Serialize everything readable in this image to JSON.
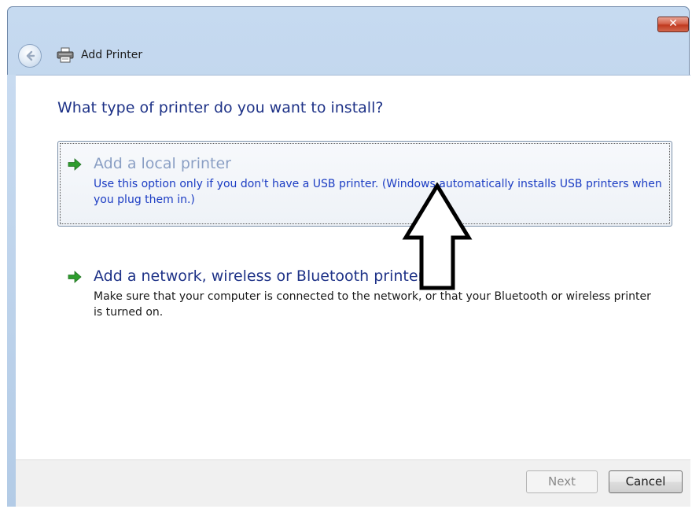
{
  "window": {
    "title": "Add Printer",
    "close_glyph": "✕"
  },
  "main": {
    "heading": "What type of printer do you want to install?",
    "options": [
      {
        "title": "Add a local printer",
        "description": "Use this option only if you don't have a USB printer. (Windows automatically installs USB printers when you plug them in.)",
        "icon": "green-arrow-icon"
      },
      {
        "title": "Add a network, wireless or Bluetooth printer",
        "description": "Make sure that your computer is connected to the network, or that your Bluetooth or wireless printer is turned on.",
        "icon": "green-arrow-icon"
      }
    ]
  },
  "footer": {
    "next_label": "Next",
    "cancel_label": "Cancel"
  },
  "colors": {
    "heading": "#1e3287",
    "link_blue": "#1b3cc3",
    "accent_green": "#2e9d2e",
    "close_red": "#c0391f"
  }
}
